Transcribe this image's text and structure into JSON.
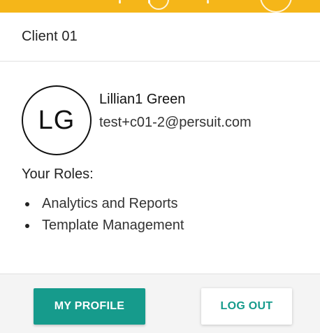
{
  "theme": {
    "header_color": "#f5b619",
    "primary_color": "#169b8c",
    "footer_background": "#f4f4f4"
  },
  "organization": {
    "name": "Client 01"
  },
  "user": {
    "initials": "LG",
    "name": "Lillian1 Green",
    "email": "test+c01-2@persuit.com"
  },
  "roles": {
    "heading": "Your Roles:",
    "items": [
      "Analytics and Reports",
      "Template Management"
    ]
  },
  "actions": {
    "my_profile_label": "MY PROFILE",
    "log_out_label": "LOG OUT"
  }
}
